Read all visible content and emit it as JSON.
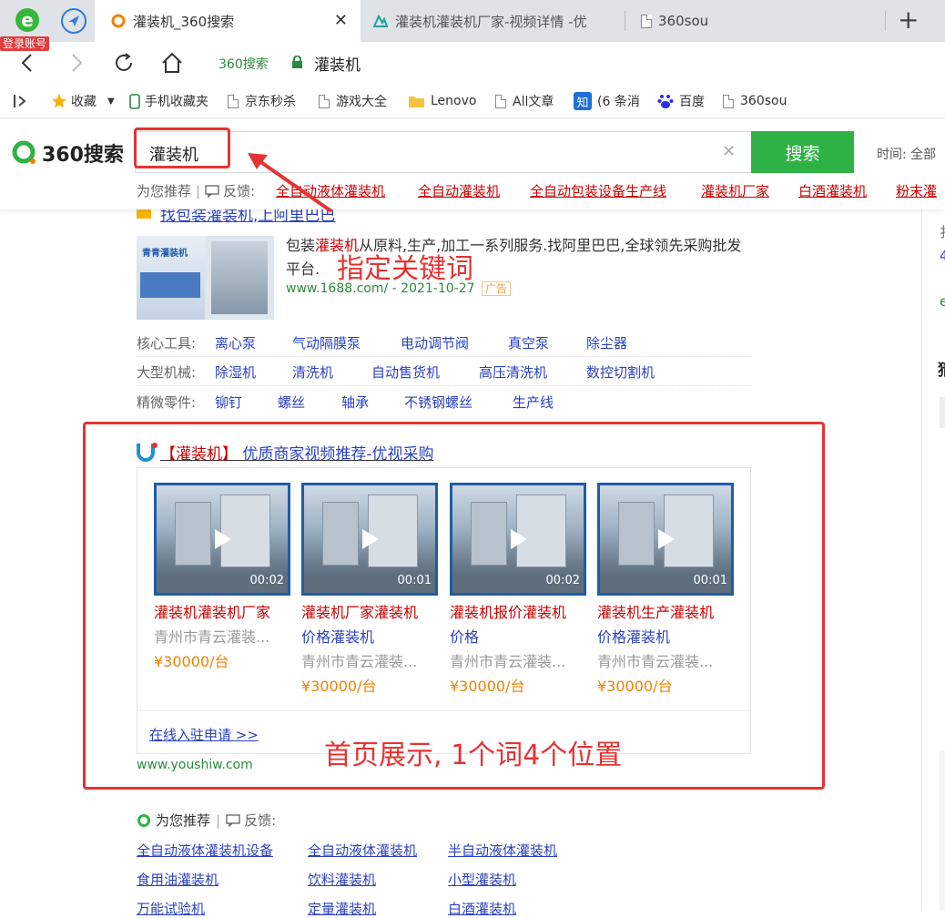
{
  "browser": {
    "login_badge": "登录账号",
    "tabs": [
      {
        "title": "灌装机_360搜索",
        "active": true
      },
      {
        "title": "灌装机灌装机厂家-视频详情 -优"
      },
      {
        "title": "360sou"
      }
    ],
    "address": {
      "site_label": "360搜索",
      "url_text": "灌装机"
    },
    "bookmarks": [
      "收藏",
      "手机收藏夹",
      "京东秒杀",
      "游戏大全",
      "Lenovo",
      "All文章",
      "(6 条消",
      "百度",
      "360sou"
    ],
    "bookmark_zhi": "知"
  },
  "search": {
    "logo_text": "360搜索",
    "query": "灌装机",
    "button": "搜索",
    "time_filter": "时间: 全部",
    "clear": "✕",
    "recommend_label": "为您推荐",
    "feedback_label": "反馈:",
    "related": [
      "全自动液体灌装机",
      "全自动灌装机",
      "全自动包装设备生产线",
      "灌装机厂家",
      "白酒灌装机",
      "粉末灌"
    ]
  },
  "ad": {
    "title": "找包装灌装机,上阿里巴巴",
    "desc_pre": "包装",
    "desc_hl": "灌装机",
    "desc_post": "从原料,生产,加工一系列服务.找阿里巴巴,全球领先采购批发平台.",
    "url": "www.1688.com/",
    "date": "- 2021-10-27",
    "ad_label": "广告",
    "thumb_text": "青青灌装机"
  },
  "categories": [
    {
      "label": "核心工具:",
      "items": [
        "离心泵",
        "气动隔膜泵",
        "电动调节阀",
        "真空泵",
        "除尘器"
      ]
    },
    {
      "label": "大型机械:",
      "items": [
        "除湿机",
        "清洗机",
        "自动售货机",
        "高压清洗机",
        "数控切割机"
      ]
    },
    {
      "label": "精微零件:",
      "items": [
        "铆钉",
        "螺丝",
        "轴承",
        "不锈钢螺丝",
        "生产线"
      ]
    }
  ],
  "video_block": {
    "title_hl": "【灌装机】",
    "title_rest": " 优质商家视频推荐-优视采购",
    "cards": [
      {
        "title_a": "灌装机灌装机厂家",
        "title_b": "",
        "seller": "青州市青云灌装...",
        "price": "¥30000/台",
        "duration": "00:02"
      },
      {
        "title_a": "灌装机厂家灌装机",
        "title_b": "价格灌装机",
        "seller": "青州市青云灌装...",
        "price": "¥30000/台",
        "duration": "00:01"
      },
      {
        "title_a": "灌装机报价灌装机",
        "title_b": "价格",
        "seller": "青州市青云灌装...",
        "price": "¥30000/台",
        "duration": "00:02"
      },
      {
        "title_a": "灌装机生产灌装机",
        "title_b": "价格灌装机",
        "seller": "青州市青云灌装...",
        "price": "¥30000/台",
        "duration": "00:01"
      }
    ],
    "join_link": "在线入驻申请 >>",
    "site": "www.youshiw.com"
  },
  "annotations": {
    "keyword": "指定关键词",
    "homepage": "首页展示, 1个词4个位置"
  },
  "bottom_rec": {
    "label": "为您推荐",
    "feedback": "反馈:",
    "links": [
      "全自动液体灌装机设备",
      "全自动液体灌装机",
      "半自动液体灌装机",
      "食用油灌装机",
      "饮料灌装机",
      "小型灌装机",
      "万能试验机",
      "定量灌装机",
      "白酒灌装机"
    ]
  },
  "right_col": {
    "c1": "扌",
    "c2": "4",
    "c3": "e",
    "c4": "猜"
  }
}
